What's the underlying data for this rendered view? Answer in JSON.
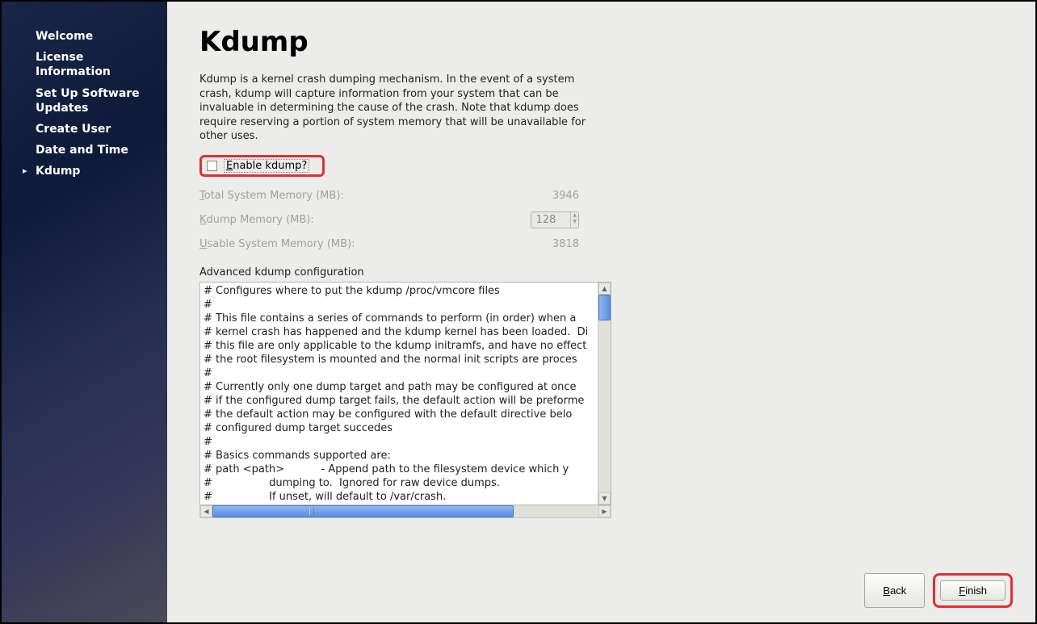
{
  "sidebar": {
    "items": [
      {
        "label": "Welcome"
      },
      {
        "label": "License Information"
      },
      {
        "label": "Set Up Software Updates"
      },
      {
        "label": "Create User"
      },
      {
        "label": "Date and Time"
      },
      {
        "label": "Kdump"
      }
    ]
  },
  "main": {
    "title": "Kdump",
    "description": "Kdump is a kernel crash dumping mechanism. In the event of a system crash, kdump will capture information from your system that can be invaluable in determining the cause of the crash. Note that kdump does require reserving a portion of system memory that will be unavailable for other uses.",
    "enable_label": "Enable kdump?",
    "memory": {
      "total_label": "Total System Memory (MB):",
      "total_value": "3946",
      "kdump_label": "Kdump Memory (MB):",
      "kdump_value": "128",
      "usable_label": "Usable System Memory (MB):",
      "usable_value": "3818"
    },
    "advanced_label": "Advanced kdump configuration",
    "config_text": "# Configures where to put the kdump /proc/vmcore files\n#\n# This file contains a series of commands to perform (in order) when a\n# kernel crash has happened and the kdump kernel has been loaded.  Di\n# this file are only applicable to the kdump initramfs, and have no effect\n# the root filesystem is mounted and the normal init scripts are proces\n#\n# Currently only one dump target and path may be configured at once\n# if the configured dump target fails, the default action will be preforme\n# the default action may be configured with the default directive belo\n# configured dump target succedes\n#\n# Basics commands supported are:\n# path <path>           - Append path to the filesystem device which y\n#                 dumping to.  Ignored for raw device dumps.\n#                 If unset, will default to /var/crash."
  },
  "footer": {
    "back": "Back",
    "finish": "Finish"
  }
}
